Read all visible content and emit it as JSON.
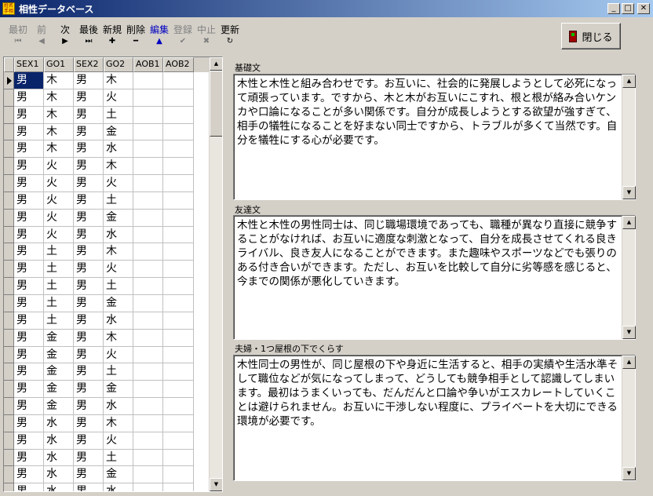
{
  "window": {
    "title": "相性データベース",
    "icon_text": "姓名\n手相"
  },
  "toolbar": {
    "buttons": [
      {
        "label": "最初",
        "icon": "⏮",
        "state": "disabled"
      },
      {
        "label": "前",
        "icon": "◀",
        "state": "disabled"
      },
      {
        "label": "次",
        "icon": "▶",
        "state": "enabled"
      },
      {
        "label": "最後",
        "icon": "⏭",
        "state": "enabled"
      },
      {
        "label": "新規",
        "icon": "✚",
        "state": "enabled"
      },
      {
        "label": "削除",
        "icon": "━",
        "state": "enabled"
      },
      {
        "label": "編集",
        "icon": "▲",
        "state": "active"
      },
      {
        "label": "登録",
        "icon": "✔",
        "state": "disabled"
      },
      {
        "label": "中止",
        "icon": "✖",
        "state": "disabled"
      },
      {
        "label": "更新",
        "icon": "↻",
        "state": "enabled"
      }
    ],
    "close_label": "閉じる"
  },
  "grid": {
    "columns": [
      "SEX1",
      "GO1",
      "SEX2",
      "GO2",
      "AOB1",
      "AOB2"
    ],
    "rows": [
      [
        "男",
        "木",
        "男",
        "木",
        "",
        ""
      ],
      [
        "男",
        "木",
        "男",
        "火",
        "",
        ""
      ],
      [
        "男",
        "木",
        "男",
        "土",
        "",
        ""
      ],
      [
        "男",
        "木",
        "男",
        "金",
        "",
        ""
      ],
      [
        "男",
        "木",
        "男",
        "水",
        "",
        ""
      ],
      [
        "男",
        "火",
        "男",
        "木",
        "",
        ""
      ],
      [
        "男",
        "火",
        "男",
        "火",
        "",
        ""
      ],
      [
        "男",
        "火",
        "男",
        "土",
        "",
        ""
      ],
      [
        "男",
        "火",
        "男",
        "金",
        "",
        ""
      ],
      [
        "男",
        "火",
        "男",
        "水",
        "",
        ""
      ],
      [
        "男",
        "土",
        "男",
        "木",
        "",
        ""
      ],
      [
        "男",
        "土",
        "男",
        "火",
        "",
        ""
      ],
      [
        "男",
        "土",
        "男",
        "土",
        "",
        ""
      ],
      [
        "男",
        "土",
        "男",
        "金",
        "",
        ""
      ],
      [
        "男",
        "土",
        "男",
        "水",
        "",
        ""
      ],
      [
        "男",
        "金",
        "男",
        "木",
        "",
        ""
      ],
      [
        "男",
        "金",
        "男",
        "火",
        "",
        ""
      ],
      [
        "男",
        "金",
        "男",
        "土",
        "",
        ""
      ],
      [
        "男",
        "金",
        "男",
        "金",
        "",
        ""
      ],
      [
        "男",
        "金",
        "男",
        "水",
        "",
        ""
      ],
      [
        "男",
        "水",
        "男",
        "木",
        "",
        ""
      ],
      [
        "男",
        "水",
        "男",
        "火",
        "",
        ""
      ],
      [
        "男",
        "水",
        "男",
        "土",
        "",
        ""
      ],
      [
        "男",
        "水",
        "男",
        "金",
        "",
        ""
      ],
      [
        "男",
        "水",
        "男",
        "水",
        "",
        ""
      ]
    ]
  },
  "sections": [
    {
      "label": "基礎文",
      "text": "木性と木性と組み合わせです。お互いに、社会的に発展しようとして必死になって頑張っています。ですから、木と木がお互いにこすれ、根と根が絡み合いケンカや口論になることが多い関係です。自分が成長しようとする欲望が強すぎて、相手の犠牲になることを好まない同士ですから、トラブルが多くて当然です。自分を犠牲にする心が必要です。"
    },
    {
      "label": "友達文",
      "text": "木性と木性の男性同士は、同じ職場環境であっても、職種が異なり直接に競争することがなければ、お互いに適度な刺激となって、自分を成長させてくれる良きライバル、良き友人になることができます。また趣味やスポーツなどでも張りのある付き合いができます。ただし、お互いを比較して自分に劣等感を感じると、今までの関係が悪化していきます。"
    },
    {
      "label": "夫婦・1つ屋根の下でくらす",
      "text": "木性同士の男性が、同じ屋根の下や身近に生活すると、相手の実績や生活水準そして職位などが気になってしまって、どうしても競争相手として認識してしまいます。最初はうまくいっても、だんだんと口論や争いがエスカレートしていくことは避けられません。お互いに干渉しない程度に、プライベートを大切にできる環境が必要です。"
    }
  ]
}
